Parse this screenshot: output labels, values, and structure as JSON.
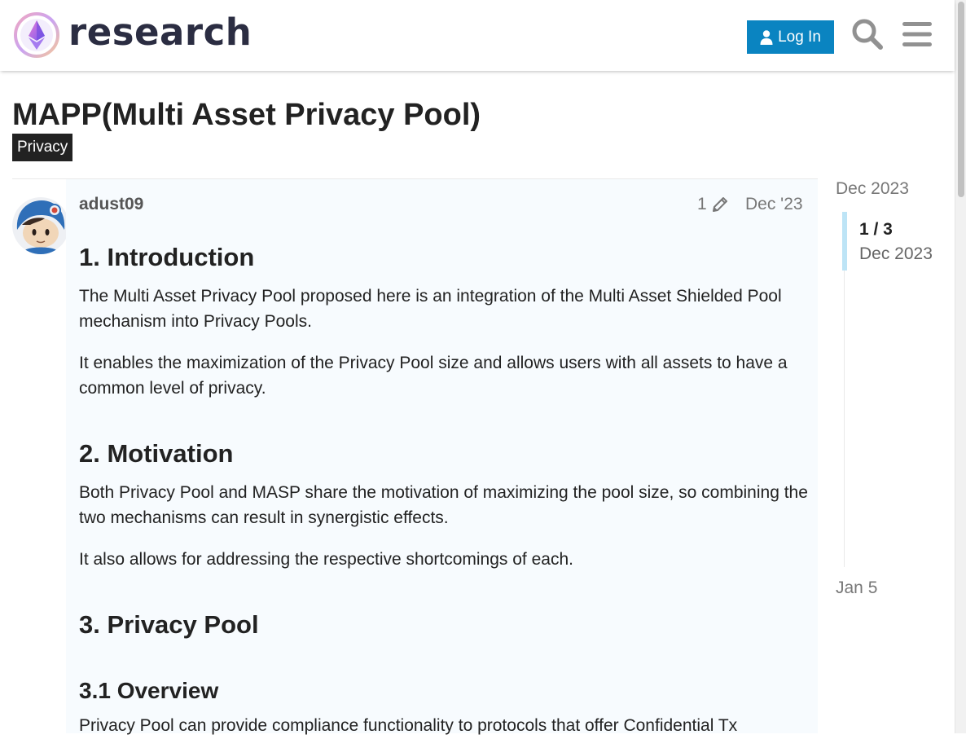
{
  "header": {
    "logo_text": "research",
    "login_label": "Log In",
    "search_icon": "search-icon",
    "menu_icon": "hamburger-menu-icon"
  },
  "topic": {
    "title": "MAPP(Multi Asset Privacy Pool)",
    "category": "Privacy"
  },
  "post": {
    "username": "adust09",
    "edit_count": "1",
    "date": "Dec '23",
    "content": {
      "h1_intro": "1. Introduction",
      "p_intro_1": "The Multi Asset Privacy Pool proposed here is an integration of the Multi Asset Shielded Pool mechanism into Privacy Pools.",
      "p_intro_2": "It enables the maximization of the Privacy Pool size and allows users with all assets to have a common level of privacy.",
      "h1_motivation": "2. Motivation",
      "p_motivation_1": "Both Privacy Pool and MASP share the motivation of maximizing the pool size, so combining the two mechanisms can result in synergistic effects.",
      "p_motivation_2": "It also allows for addressing the respective shortcomings of each.",
      "h1_privacy_pool": "3. Privacy Pool",
      "h2_overview": "3.1 Overview",
      "p_overview": "Privacy Pool can provide compliance functionality to protocols that offer Confidential Tx"
    }
  },
  "timeline": {
    "start": "Dec 2023",
    "count": "1 / 3",
    "count_date": "Dec 2023",
    "end": "Jan 5"
  },
  "colors": {
    "accent": "#0a84c1",
    "category_bg": "#222222",
    "post_bg": "#f7fbfe",
    "timeline_handle": "#bde4f6"
  }
}
